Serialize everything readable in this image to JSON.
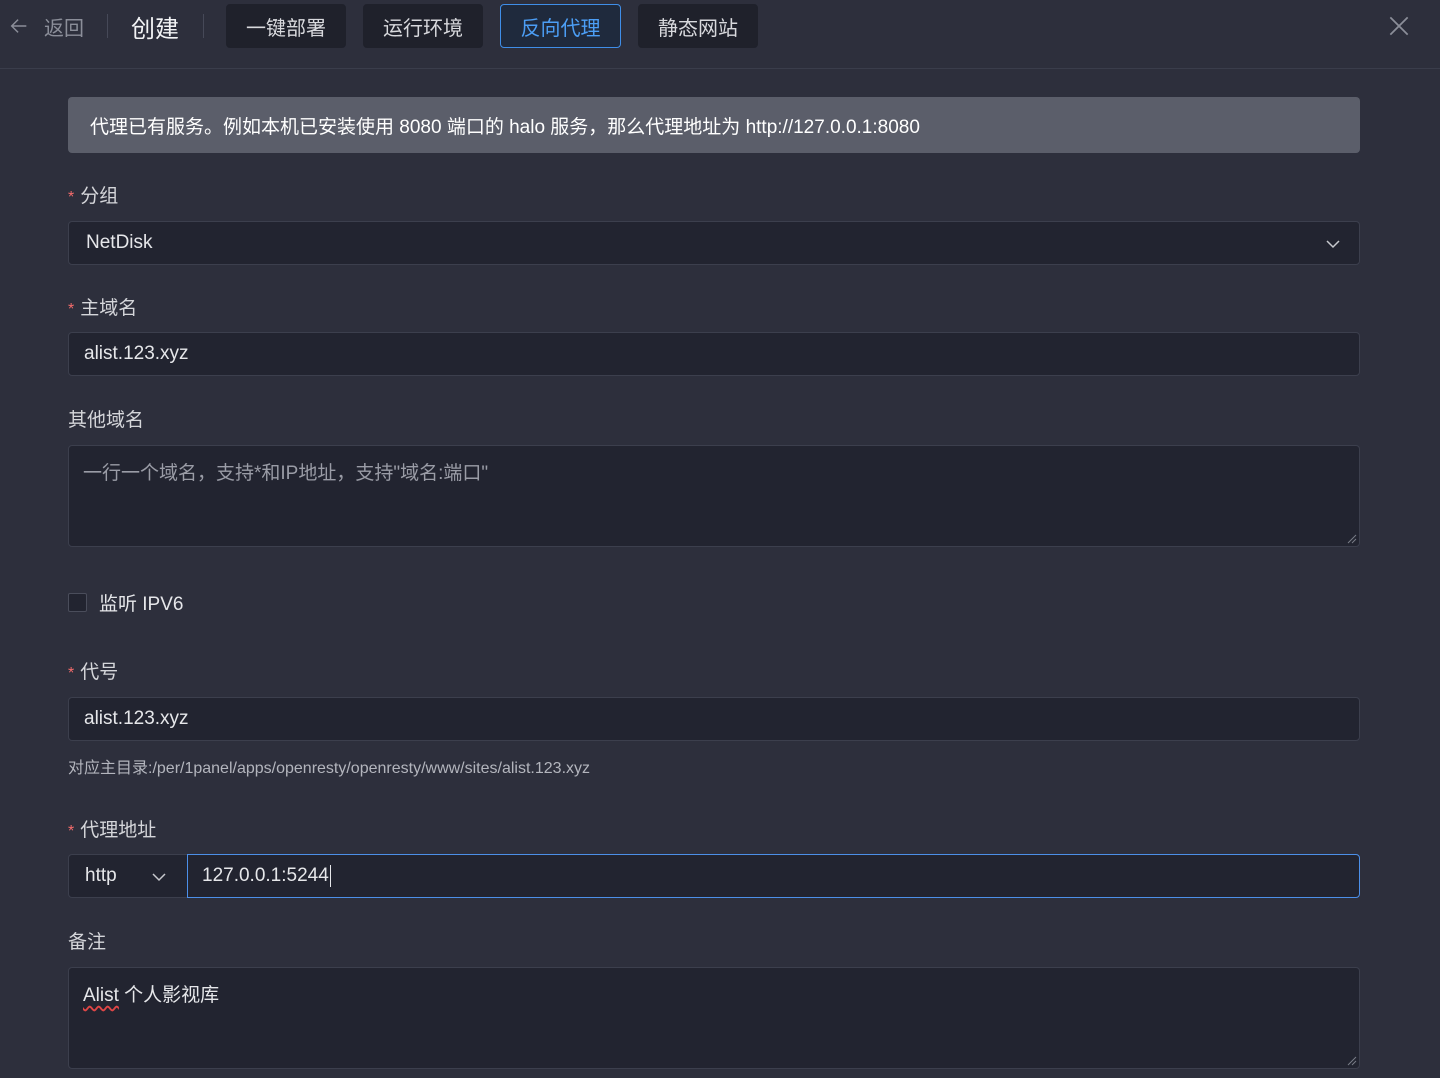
{
  "header": {
    "back_label": "返回",
    "title": "创建",
    "tabs": [
      {
        "label": "一键部署",
        "active": false
      },
      {
        "label": "运行环境",
        "active": false
      },
      {
        "label": "反向代理",
        "active": true
      },
      {
        "label": "静态网站",
        "active": false
      }
    ],
    "icons": {
      "back": "arrow-left-icon",
      "close": "close-icon"
    }
  },
  "alert": {
    "text": "代理已有服务。例如本机已安装使用 8080 端口的 halo 服务，那么代理地址为 http://127.0.0.1:8080"
  },
  "form": {
    "group": {
      "label": "分组",
      "required": "*",
      "value": "NetDisk"
    },
    "primary_domain": {
      "label": "主域名",
      "required": "*",
      "value": "alist.123.xyz"
    },
    "other_domains": {
      "label": "其他域名",
      "placeholder": "一行一个域名，支持*和IP地址，支持\"域名:端口\""
    },
    "ipv6": {
      "label": "监听 IPV6",
      "checked": false
    },
    "alias": {
      "label": "代号",
      "required": "*",
      "value": "alist.123.xyz",
      "hint": "对应主目录:/per/1panel/apps/openresty/openresty/www/sites/alist.123.xyz"
    },
    "proxy": {
      "label": "代理地址",
      "required": "*",
      "protocol": "http",
      "address": "127.0.0.1:5244"
    },
    "remark": {
      "label": "备注",
      "value_word": "Alist",
      "value_rest": " 个人影视库"
    }
  },
  "colors": {
    "background": "#2d2f3c",
    "input_bg": "#222430",
    "accent": "#4c9ef5",
    "required": "#f56c6c",
    "alert_bg": "#5b5e6a"
  }
}
